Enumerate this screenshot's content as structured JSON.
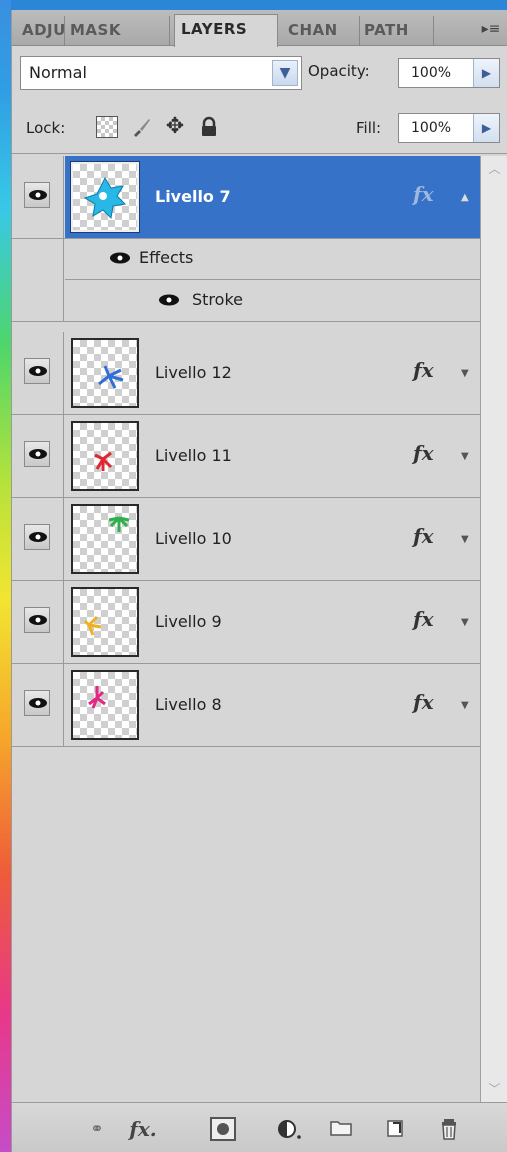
{
  "tabs": [
    {
      "label": "ADJU"
    },
    {
      "label": "MASK"
    },
    {
      "label": "LAYERS"
    },
    {
      "label": "CHAN"
    },
    {
      "label": "PATH"
    }
  ],
  "blend": {
    "mode": "Normal",
    "opacity_label": "Opacity:",
    "opacity_value": "100%"
  },
  "lock": {
    "label": "Lock:",
    "fill_label": "Fill:",
    "fill_value": "100%"
  },
  "layers": [
    {
      "name": "Livello 7",
      "selected": true,
      "fx": "fx",
      "thumb_color": "#29b8e6"
    },
    {
      "name": "Livello 12",
      "selected": false,
      "fx": "fx",
      "thumb_color": "#2f6fd6"
    },
    {
      "name": "Livello 11",
      "selected": false,
      "fx": "fx",
      "thumb_color": "#e0262e"
    },
    {
      "name": "Livello 10",
      "selected": false,
      "fx": "fx",
      "thumb_color": "#2fb04a"
    },
    {
      "name": "Livello 9",
      "selected": false,
      "fx": "fx",
      "thumb_color": "#f0b020"
    },
    {
      "name": "Livello 8",
      "selected": false,
      "fx": "fx",
      "thumb_color": "#e0287e"
    }
  ],
  "effects": {
    "label": "Effects",
    "items": [
      "Stroke"
    ]
  },
  "bottom_toolbar": {
    "fx": "fx"
  },
  "colors": {
    "selection": "#3572c8",
    "panel": "#d6d6d6",
    "accent": "#1f7fd6"
  }
}
